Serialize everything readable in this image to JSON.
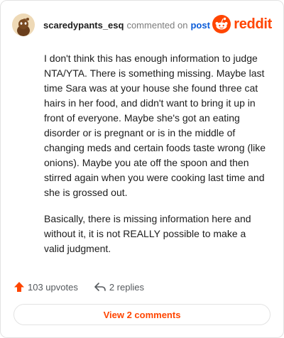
{
  "header": {
    "username": "scaredypants_esq",
    "action": "commented on",
    "post_link": "post",
    "logo_text": "reddit"
  },
  "comment": {
    "paragraphs": [
      "I don't think this has enough information to judge NTA/YTA. There is something missing. Maybe last time Sara was at your house she found three cat hairs in her food, and didn't want to bring it up in front of everyone. Maybe she's got an eating disorder or is pregnant or is in the middle of changing meds and certain foods taste wrong (like onions). Maybe you ate off the spoon and then stirred again when you were cooking last time and she is grossed out.",
      "Basically, there is missing information here and without it, it is not REALLY possible to make a valid judgment."
    ]
  },
  "footer": {
    "upvotes": "103 upvotes",
    "replies": "2 replies",
    "view_comments": "View 2 comments"
  },
  "icons": {
    "avatar": "snoo-avatar-icon",
    "logo": "reddit-logo-icon",
    "upvote": "upvote-arrow-icon",
    "reply": "reply-arrow-icon"
  },
  "colors": {
    "brand": "#ff4500",
    "link": "#0a5bd8",
    "muted": "#7c7c7c",
    "border": "#e3e3e3"
  }
}
